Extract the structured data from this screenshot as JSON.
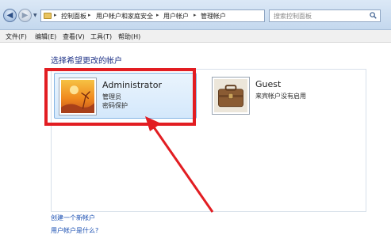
{
  "address_bar": {
    "breadcrumbs": [
      "控制面板",
      "用户帐户和家庭安全",
      "用户帐户",
      "管理帐户"
    ],
    "search_placeholder": "搜索控制面板"
  },
  "menu": [
    "文件(F)",
    "编辑(E)",
    "查看(V)",
    "工具(T)",
    "帮助(H)"
  ],
  "main": {
    "heading": "选择希望更改的帐户",
    "accounts": [
      {
        "name": "Administrator",
        "line1": "管理员",
        "line2": "密码保护",
        "icon": "sunset-flower-avatar-icon"
      },
      {
        "name": "Guest",
        "line1": "来宾帐户没有启用",
        "line2": "",
        "icon": "briefcase-avatar-icon"
      }
    ],
    "links": [
      "创建一个新帐户",
      "用户帐户是什么?"
    ]
  },
  "colors": {
    "highlight": "#e21d22",
    "link": "#1a4fb2",
    "heading": "#1e3287"
  }
}
